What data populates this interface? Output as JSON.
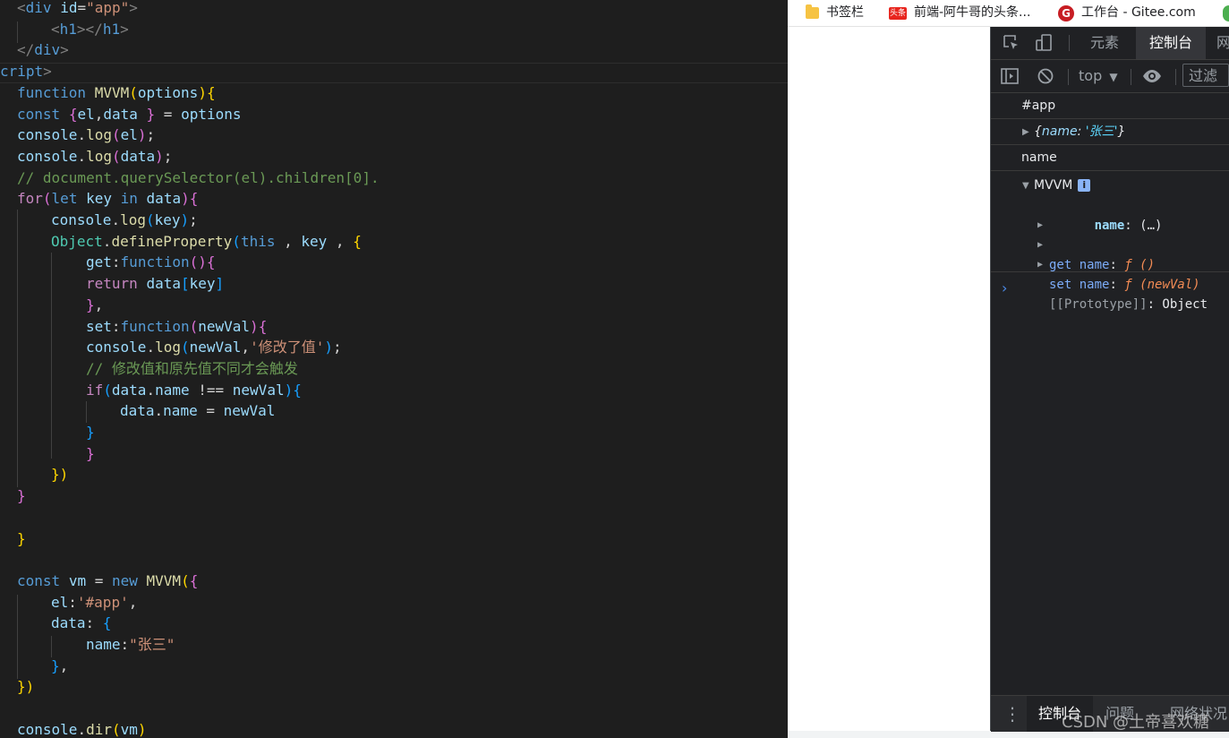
{
  "editor": {
    "lines": [
      [
        [
          "<",
          "t-tag"
        ],
        [
          "div",
          "t-tn"
        ],
        [
          " ",
          "t-txt"
        ],
        [
          "id",
          "t-an"
        ],
        [
          "=",
          "t-txt"
        ],
        [
          "\"app\"",
          "t-str"
        ],
        [
          ">",
          "t-tag"
        ]
      ],
      [
        [
          "<",
          "t-tag"
        ],
        [
          "h1",
          "t-tn"
        ],
        [
          "></",
          "t-tag"
        ],
        [
          "h1",
          "t-tn"
        ],
        [
          ">",
          "t-tag"
        ]
      ],
      [
        [
          "</",
          "t-tag"
        ],
        [
          "div",
          "t-tn"
        ],
        [
          ">",
          "t-tag"
        ]
      ],
      [
        [
          "cript",
          "t-tn"
        ],
        [
          ">",
          "t-tag"
        ]
      ],
      [
        [
          "function",
          "t-kw"
        ],
        [
          " ",
          "t-txt"
        ],
        [
          "MVVM",
          "t-fn"
        ],
        [
          "(",
          "t-b1"
        ],
        [
          "options",
          "t-var"
        ],
        [
          ")",
          "t-b1"
        ],
        [
          "{",
          "t-b1"
        ]
      ],
      [
        [
          "const",
          "t-kw"
        ],
        [
          " ",
          "t-txt"
        ],
        [
          "{",
          "t-b2"
        ],
        [
          "el",
          "t-var"
        ],
        [
          ",",
          "t-txt"
        ],
        [
          "data",
          "t-var"
        ],
        [
          " ",
          "t-txt"
        ],
        [
          "}",
          "t-b2"
        ],
        [
          " = ",
          "t-txt"
        ],
        [
          "options",
          "t-var"
        ]
      ],
      [
        [
          "console",
          "t-var"
        ],
        [
          ".",
          "t-txt"
        ],
        [
          "log",
          "t-fn"
        ],
        [
          "(",
          "t-b2"
        ],
        [
          "el",
          "t-var"
        ],
        [
          ")",
          "t-b2"
        ],
        [
          ";",
          "t-txt"
        ]
      ],
      [
        [
          "console",
          "t-var"
        ],
        [
          ".",
          "t-txt"
        ],
        [
          "log",
          "t-fn"
        ],
        [
          "(",
          "t-b2"
        ],
        [
          "data",
          "t-var"
        ],
        [
          ")",
          "t-b2"
        ],
        [
          ";",
          "t-txt"
        ]
      ],
      [
        [
          "// document.querySelector(el).children[0].",
          "t-com"
        ]
      ],
      [
        [
          "for",
          "t-ctl"
        ],
        [
          "(",
          "t-b2"
        ],
        [
          "let",
          "t-kw"
        ],
        [
          " ",
          "t-txt"
        ],
        [
          "key",
          "t-var"
        ],
        [
          " ",
          "t-txt"
        ],
        [
          "in",
          "t-kw"
        ],
        [
          " ",
          "t-txt"
        ],
        [
          "data",
          "t-var"
        ],
        [
          ")",
          "t-b2"
        ],
        [
          "{",
          "t-b2"
        ]
      ],
      [
        [
          "console",
          "t-var"
        ],
        [
          ".",
          "t-txt"
        ],
        [
          "log",
          "t-fn"
        ],
        [
          "(",
          "t-b3"
        ],
        [
          "key",
          "t-var"
        ],
        [
          ")",
          "t-b3"
        ],
        [
          ";",
          "t-txt"
        ]
      ],
      [
        [
          "Object",
          "t-cls"
        ],
        [
          ".",
          "t-txt"
        ],
        [
          "defineProperty",
          "t-fn"
        ],
        [
          "(",
          "t-b3"
        ],
        [
          "this",
          "t-kw"
        ],
        [
          " , ",
          "t-txt"
        ],
        [
          "key",
          "t-var"
        ],
        [
          " , ",
          "t-txt"
        ],
        [
          "{",
          "t-b1"
        ]
      ],
      [
        [
          "get",
          "t-var"
        ],
        [
          ":",
          "t-txt"
        ],
        [
          "function",
          "t-kw"
        ],
        [
          "()",
          "t-b2"
        ],
        [
          "{",
          "t-b2"
        ]
      ],
      [
        [
          "return",
          "t-ctl"
        ],
        [
          " ",
          "t-txt"
        ],
        [
          "data",
          "t-var"
        ],
        [
          "[",
          "t-b3"
        ],
        [
          "key",
          "t-var"
        ],
        [
          "]",
          "t-b3"
        ]
      ],
      [
        [
          "}",
          "t-b2"
        ],
        [
          ",",
          "t-txt"
        ]
      ],
      [
        [
          "set",
          "t-var"
        ],
        [
          ":",
          "t-txt"
        ],
        [
          "function",
          "t-kw"
        ],
        [
          "(",
          "t-b2"
        ],
        [
          "newVal",
          "t-var"
        ],
        [
          ")",
          "t-b2"
        ],
        [
          "{",
          "t-b2"
        ]
      ],
      [
        [
          "console",
          "t-var"
        ],
        [
          ".",
          "t-txt"
        ],
        [
          "log",
          "t-fn"
        ],
        [
          "(",
          "t-b3"
        ],
        [
          "newVal",
          "t-var"
        ],
        [
          ",",
          "t-txt"
        ],
        [
          "'修改了值'",
          "t-str"
        ],
        [
          ")",
          "t-b3"
        ],
        [
          ";",
          "t-txt"
        ]
      ],
      [
        [
          "// 修改值和原先值不同才会触发",
          "t-com"
        ]
      ],
      [
        [
          "if",
          "t-ctl"
        ],
        [
          "(",
          "t-b3"
        ],
        [
          "data",
          "t-var"
        ],
        [
          ".",
          "t-txt"
        ],
        [
          "name",
          "t-var"
        ],
        [
          " !== ",
          "t-txt"
        ],
        [
          "newVal",
          "t-var"
        ],
        [
          ")",
          "t-b3"
        ],
        [
          "{",
          "t-b3"
        ]
      ],
      [
        [
          "data",
          "t-var"
        ],
        [
          ".",
          "t-txt"
        ],
        [
          "name",
          "t-var"
        ],
        [
          " = ",
          "t-txt"
        ],
        [
          "newVal",
          "t-var"
        ]
      ],
      [
        [
          "}",
          "t-b3"
        ]
      ],
      [
        [
          "}",
          "t-b2"
        ]
      ],
      [
        [
          "})",
          "t-b1"
        ]
      ],
      [
        [
          "}",
          "t-b2"
        ]
      ],
      [],
      [
        [
          "}",
          "t-b1"
        ]
      ],
      [],
      [
        [
          "const",
          "t-kw"
        ],
        [
          " ",
          "t-txt"
        ],
        [
          "vm",
          "t-var"
        ],
        [
          " = ",
          "t-txt"
        ],
        [
          "new",
          "t-kw"
        ],
        [
          " ",
          "t-txt"
        ],
        [
          "MVVM",
          "t-fn"
        ],
        [
          "(",
          "t-b1"
        ],
        [
          "{",
          "t-b2"
        ]
      ],
      [
        [
          "el",
          "t-var"
        ],
        [
          ":",
          "t-txt"
        ],
        [
          "'#app'",
          "t-str"
        ],
        [
          ",",
          "t-txt"
        ]
      ],
      [
        [
          "data",
          "t-var"
        ],
        [
          ": ",
          "t-txt"
        ],
        [
          "{",
          "t-b3"
        ]
      ],
      [
        [
          "name",
          "t-var"
        ],
        [
          ":",
          "t-txt"
        ],
        [
          "\"张三\"",
          "t-str"
        ]
      ],
      [
        [
          "}",
          "t-b3"
        ],
        [
          ",",
          "t-txt"
        ]
      ],
      [
        [
          "})",
          "t-b1"
        ]
      ],
      [],
      [
        [
          "console",
          "t-var"
        ],
        [
          ".",
          "t-txt"
        ],
        [
          "dir",
          "t-fn"
        ],
        [
          "(",
          "t-b1"
        ],
        [
          "vm",
          "t-var"
        ],
        [
          ")",
          "t-b1"
        ]
      ]
    ]
  },
  "bookmarks": {
    "folder_label": "书签栏",
    "toutiao_badge": "头条",
    "toutiao_label": "前端-阿牛哥的头条...",
    "gitee_badge": "G",
    "gitee_label": "工作台 - Gitee.com"
  },
  "devtools": {
    "tabs": {
      "elements": "元素",
      "console": "控制台",
      "network_partial": "网"
    },
    "toolbar": {
      "context": "top",
      "context_caret": "▼",
      "filter_placeholder": "过滤"
    },
    "console": {
      "line1": "#app",
      "line2_open": "{",
      "line2_key": "name",
      "line2_colon": ": ",
      "line2_value": "'张三'",
      "line2_close": "}",
      "line3": "name",
      "obj_name": "MVVM",
      "info": "i",
      "prop_name_key": "name",
      "prop_name_val": ": (…)",
      "getter_label": "get name",
      "getter_sig": "ƒ ()",
      "setter_label": "set name",
      "setter_sig": "ƒ (newVal)",
      "proto_label": "[[Prototype]]",
      "proto_val": ": Object",
      "colon": ": ",
      "prompt": "›"
    },
    "drawer": {
      "console": "控制台",
      "issues": "问题",
      "network": "网络状况"
    }
  },
  "watermark": "CSDN @土帝喜欢糖"
}
